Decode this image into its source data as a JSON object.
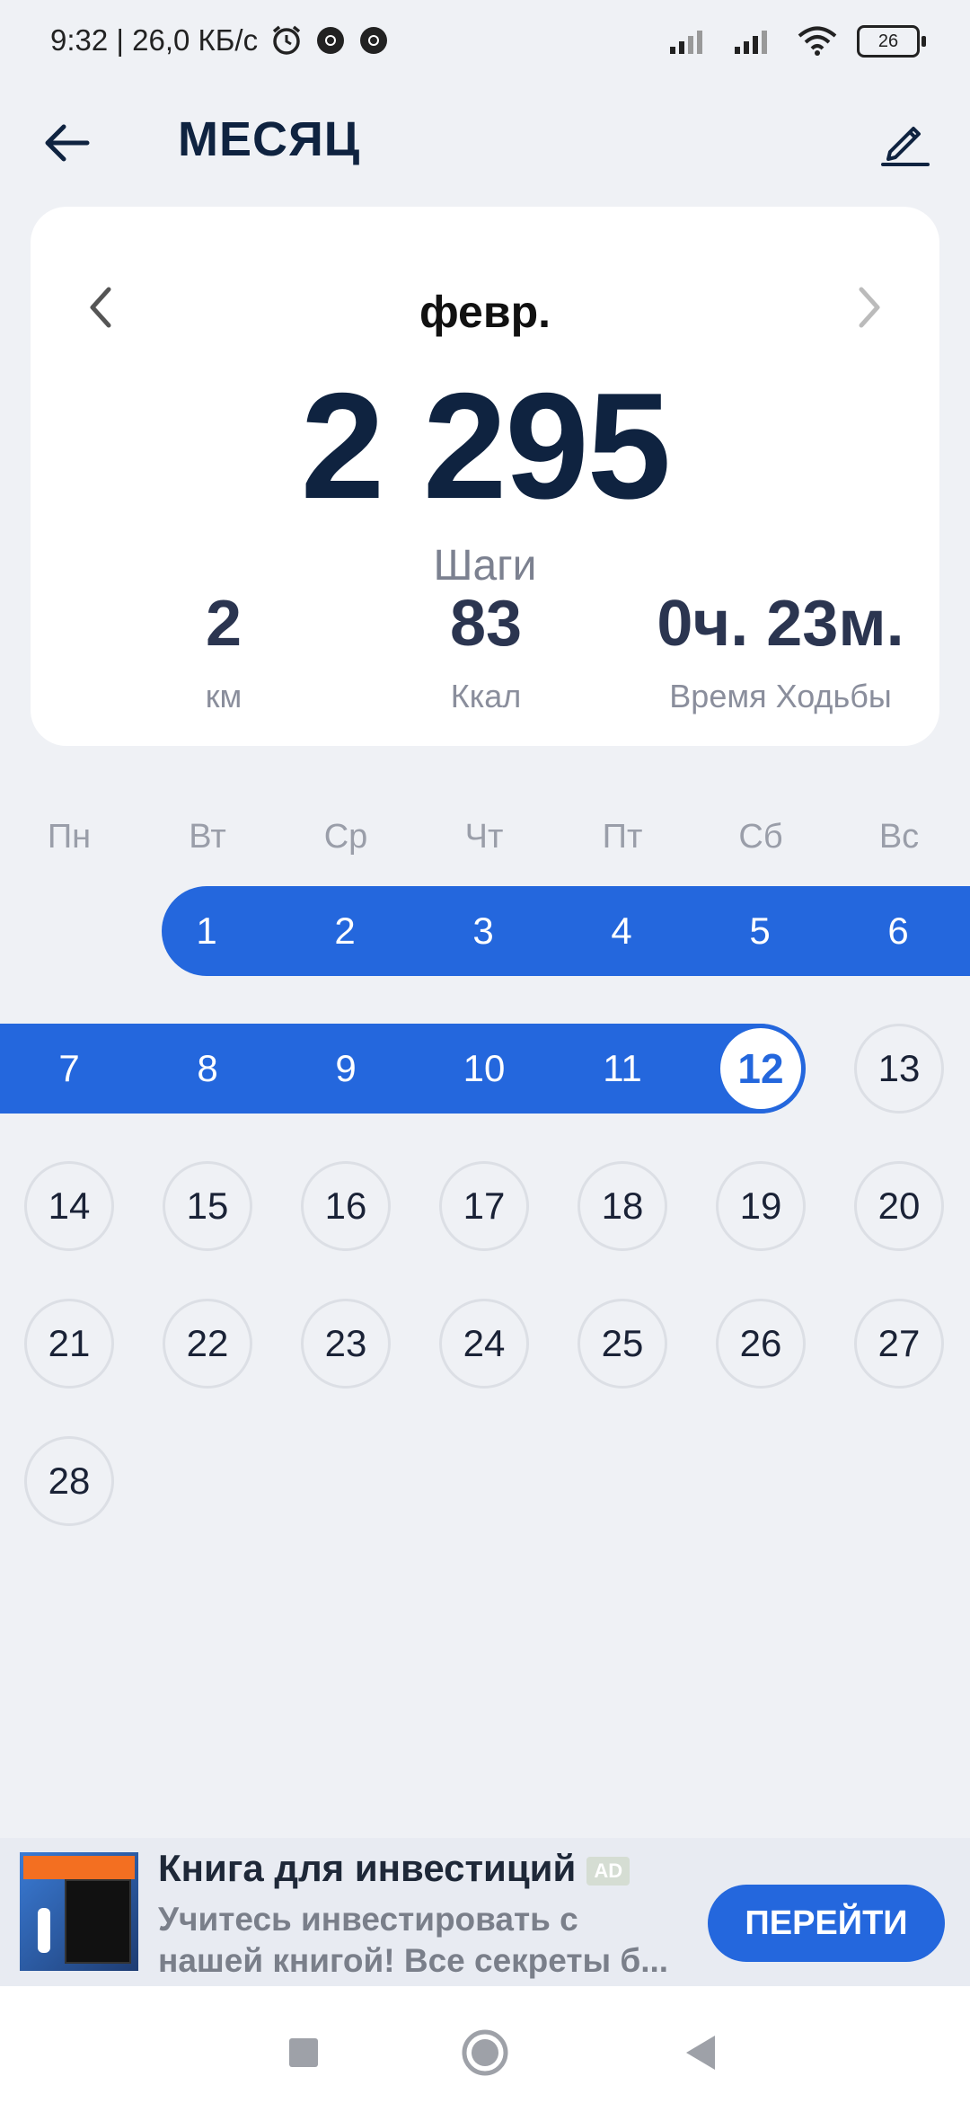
{
  "status": {
    "time_speed": "9:32 | 26,0 КБ/с",
    "battery": "26"
  },
  "header": {
    "title": "МЕСЯЦ"
  },
  "summary": {
    "month": "февр.",
    "steps_value": "2 295",
    "steps_label": "Шаги",
    "distance_value": "2",
    "distance_unit": "км",
    "calories_value": "83",
    "calories_unit": "Ккал",
    "time_value": "0ч. 23м.",
    "time_label": "Время Ходьбы"
  },
  "calendar": {
    "weekdays": [
      "Пн",
      "Вт",
      "Ср",
      "Чт",
      "Пт",
      "Сб",
      "Вс"
    ],
    "days": [
      "1",
      "2",
      "3",
      "4",
      "5",
      "6",
      "7",
      "8",
      "9",
      "10",
      "11",
      "12",
      "13",
      "14",
      "15",
      "16",
      "17",
      "18",
      "19",
      "20",
      "21",
      "22",
      "23",
      "24",
      "25",
      "26",
      "27",
      "28"
    ],
    "selected_day": "12",
    "accent_color": "#2467DD"
  },
  "ad": {
    "title": "Книга для инвестиций",
    "badge": "AD",
    "line1": "Учитесь инвестировать с",
    "line2": "нашей книгой! Все секреты б...",
    "button": "ПЕРЕЙТИ"
  }
}
